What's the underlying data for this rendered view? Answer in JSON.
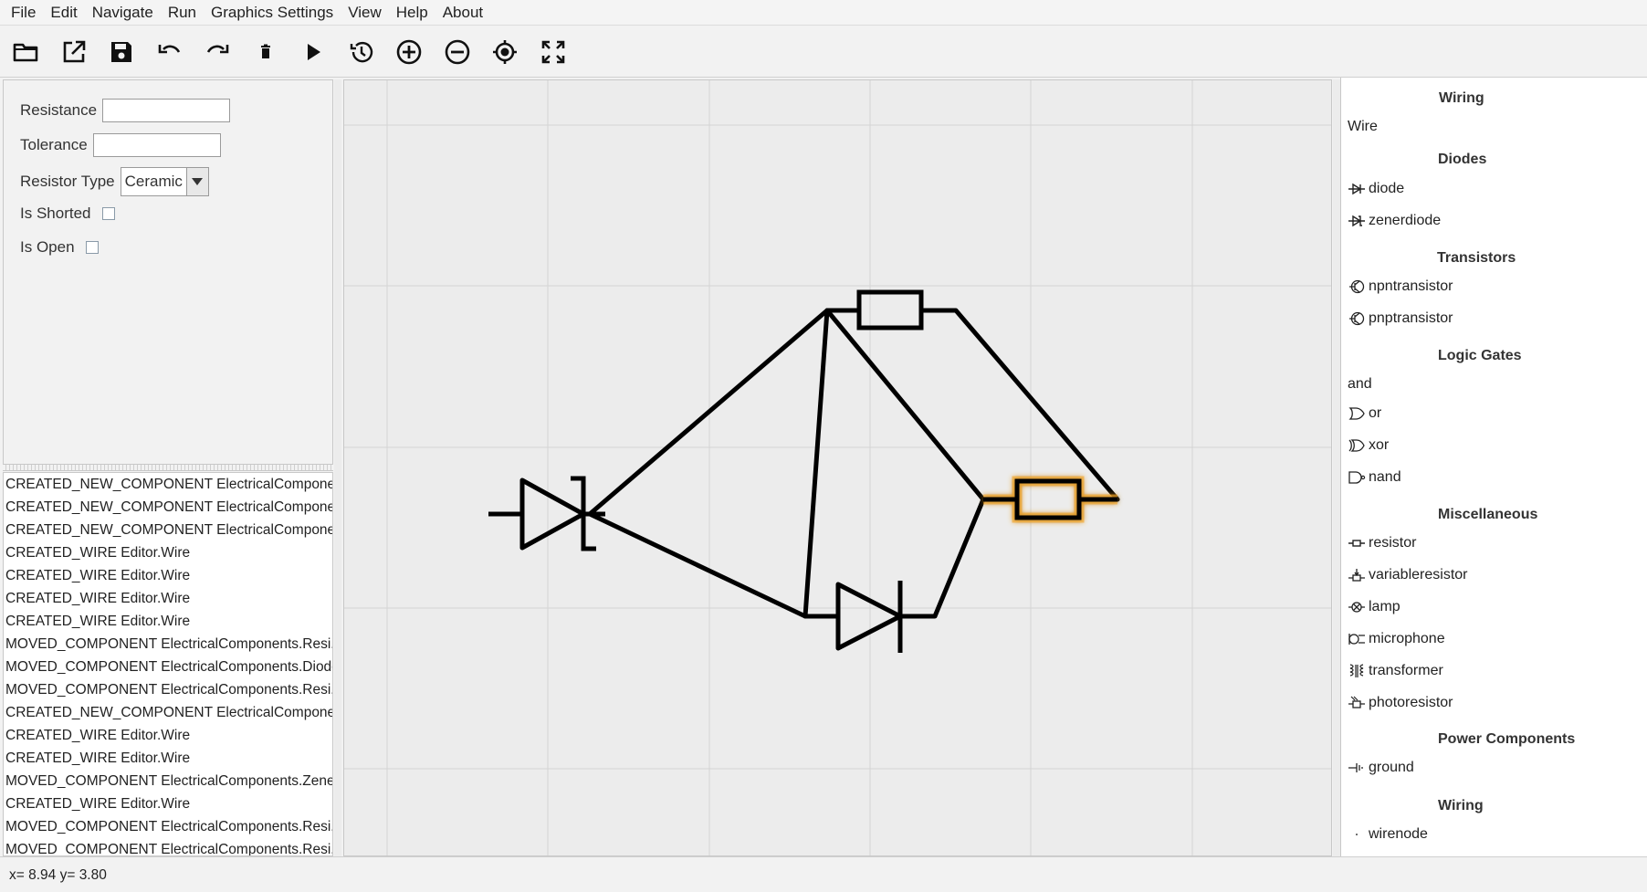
{
  "menu": [
    "File",
    "Edit",
    "Navigate",
    "Run",
    "Graphics Settings",
    "View",
    "Help",
    "About"
  ],
  "toolbar": [
    {
      "name": "open-folder-icon"
    },
    {
      "name": "export-icon"
    },
    {
      "name": "save-icon"
    },
    {
      "name": "undo-icon"
    },
    {
      "name": "redo-icon"
    },
    {
      "name": "delete-icon"
    },
    {
      "name": "run-icon"
    },
    {
      "name": "history-icon"
    },
    {
      "name": "zoom-in-icon"
    },
    {
      "name": "zoom-out-icon"
    },
    {
      "name": "center-icon"
    },
    {
      "name": "fullscreen-icon"
    }
  ],
  "properties": {
    "resistance_label": "Resistance",
    "resistance_value": "",
    "tolerance_label": "Tolerance",
    "tolerance_value": "",
    "resistor_type_label": "Resistor Type",
    "resistor_type_value": "Ceramic",
    "is_shorted_label": "Is Shorted",
    "is_open_label": "Is Open"
  },
  "log": [
    "CREATED_NEW_COMPONENT ElectricalCompone...",
    "CREATED_NEW_COMPONENT ElectricalCompone...",
    "CREATED_NEW_COMPONENT ElectricalCompone...",
    "CREATED_WIRE Editor.Wire",
    "CREATED_WIRE Editor.Wire",
    "CREATED_WIRE Editor.Wire",
    "CREATED_WIRE Editor.Wire",
    "MOVED_COMPONENT ElectricalComponents.Resi...",
    "MOVED_COMPONENT ElectricalComponents.Diode",
    "MOVED_COMPONENT ElectricalComponents.Resi...",
    "CREATED_NEW_COMPONENT ElectricalCompone...",
    "CREATED_WIRE Editor.Wire",
    "CREATED_WIRE Editor.Wire",
    "MOVED_COMPONENT ElectricalComponents.Zene...",
    "CREATED_WIRE Editor.Wire",
    "MOVED_COMPONENT ElectricalComponents.Resi...",
    "MOVED_COMPONENT ElectricalComponents.Resi..."
  ],
  "palette": {
    "wiring_header": "Wiring",
    "wire_item": "Wire",
    "diodes_header": "Diodes",
    "diode": "diode",
    "zenerdiode": "zenerdiode",
    "transistors_header": "Transistors",
    "npntransistor": "npntransistor",
    "pnptransistor": "pnptransistor",
    "logic_header": "Logic Gates",
    "and": "and",
    "or": "or",
    "xor": "xor",
    "nand": "nand",
    "misc_header": "Miscellaneous",
    "resistor": "resistor",
    "variableresistor": "variableresistor",
    "lamp": "lamp",
    "microphone": "microphone",
    "transformer": "transformer",
    "photoresistor": "photoresistor",
    "power_header": "Power Components",
    "ground": "ground",
    "wiring2_header": "Wiring",
    "wirenode": "wirenode"
  },
  "status": "x= 8.94 y= 3.80",
  "colors": {
    "selection_glow": "#f5a623",
    "wire": "#000000",
    "grid": "#d4d4d4"
  }
}
